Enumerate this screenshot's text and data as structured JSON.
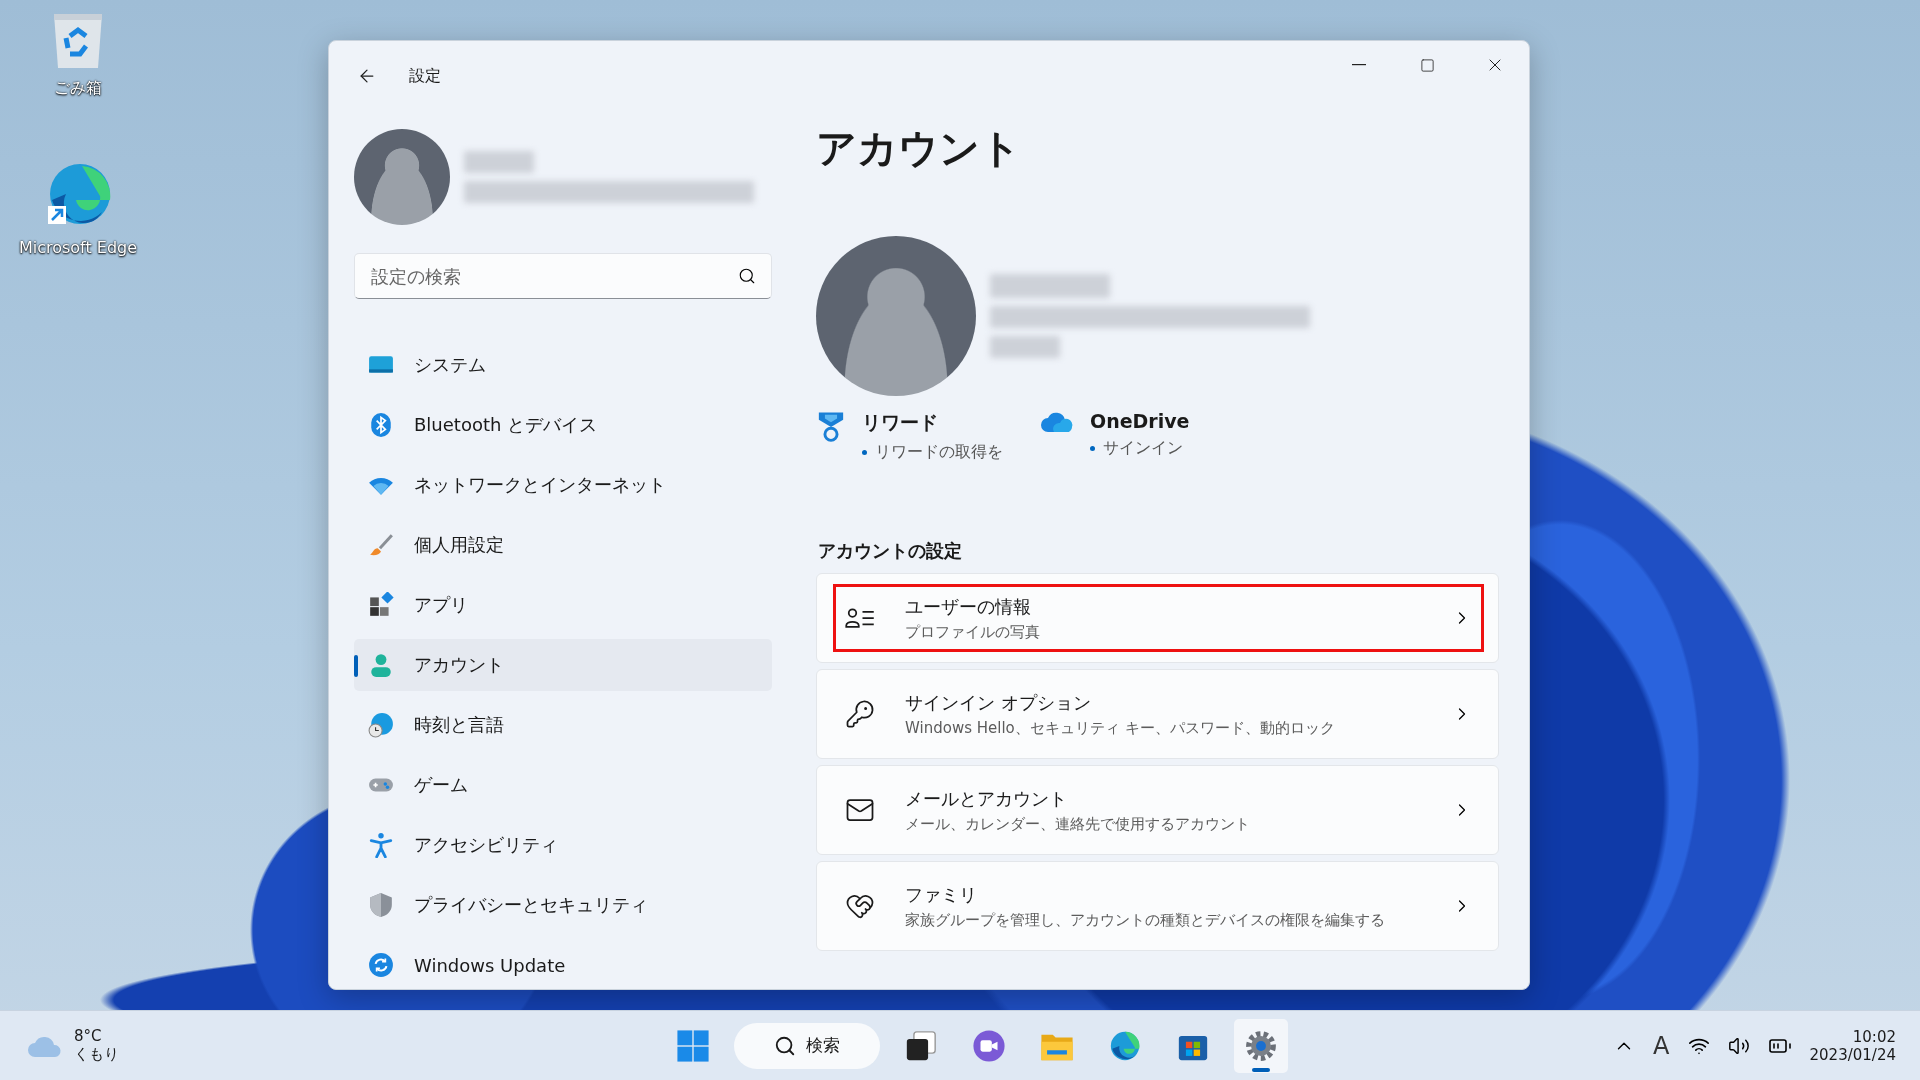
{
  "desktop_icons": [
    {
      "kind": "recycle",
      "label": "ごみ箱"
    },
    {
      "kind": "edge",
      "label": "Microsoft Edge"
    }
  ],
  "window": {
    "title": "設定"
  },
  "search": {
    "placeholder": "設定の検索"
  },
  "nav": [
    {
      "kind": "system",
      "label": "システム",
      "selected": false
    },
    {
      "kind": "bluetooth",
      "label": "Bluetooth とデバイス",
      "selected": false
    },
    {
      "kind": "network",
      "label": "ネットワークとインターネット",
      "selected": false
    },
    {
      "kind": "brush",
      "label": "個人用設定",
      "selected": false
    },
    {
      "kind": "apps",
      "label": "アプリ",
      "selected": false
    },
    {
      "kind": "account",
      "label": "アカウント",
      "selected": true
    },
    {
      "kind": "time",
      "label": "時刻と言語",
      "selected": false
    },
    {
      "kind": "gaming",
      "label": "ゲーム",
      "selected": false
    },
    {
      "kind": "accessibility",
      "label": "アクセシビリティ",
      "selected": false
    },
    {
      "kind": "privacy",
      "label": "プライバシーとセキュリティ",
      "selected": false
    },
    {
      "kind": "update",
      "label": "Windows Update",
      "selected": false
    }
  ],
  "page": {
    "title": "アカウント",
    "services": [
      {
        "kind": "rewards",
        "name": "リワード",
        "status": "リワードの取得を"
      },
      {
        "kind": "onedrive",
        "name": "OneDrive",
        "status": "サインイン"
      }
    ],
    "section": "アカウントの設定",
    "items": [
      {
        "kind": "user-info",
        "title": "ユーザーの情報",
        "subtitle": "プロファイルの写真",
        "highlighted": true
      },
      {
        "kind": "key",
        "title": "サインイン オプション",
        "subtitle": "Windows Hello、セキュリティ キー、パスワード、動的ロック",
        "highlighted": false
      },
      {
        "kind": "mail",
        "title": "メールとアカウント",
        "subtitle": "メール、カレンダー、連絡先で使用するアカウント",
        "highlighted": false
      },
      {
        "kind": "family",
        "title": "ファミリ",
        "subtitle": "家族グループを管理し、アカウントの種類とデバイスの権限を編集する",
        "highlighted": false
      }
    ]
  },
  "taskbar": {
    "weather": {
      "temp": "8°C",
      "condition": "くもり"
    },
    "search_label": "検索",
    "apps": [
      {
        "kind": "task-view",
        "active": false
      },
      {
        "kind": "chat",
        "active": false
      },
      {
        "kind": "explorer",
        "active": false
      },
      {
        "kind": "edge",
        "active": false
      },
      {
        "kind": "store",
        "active": false
      },
      {
        "kind": "settings",
        "active": true
      }
    ],
    "ime": "A",
    "time": "10:02",
    "date": "2023/01/24"
  }
}
